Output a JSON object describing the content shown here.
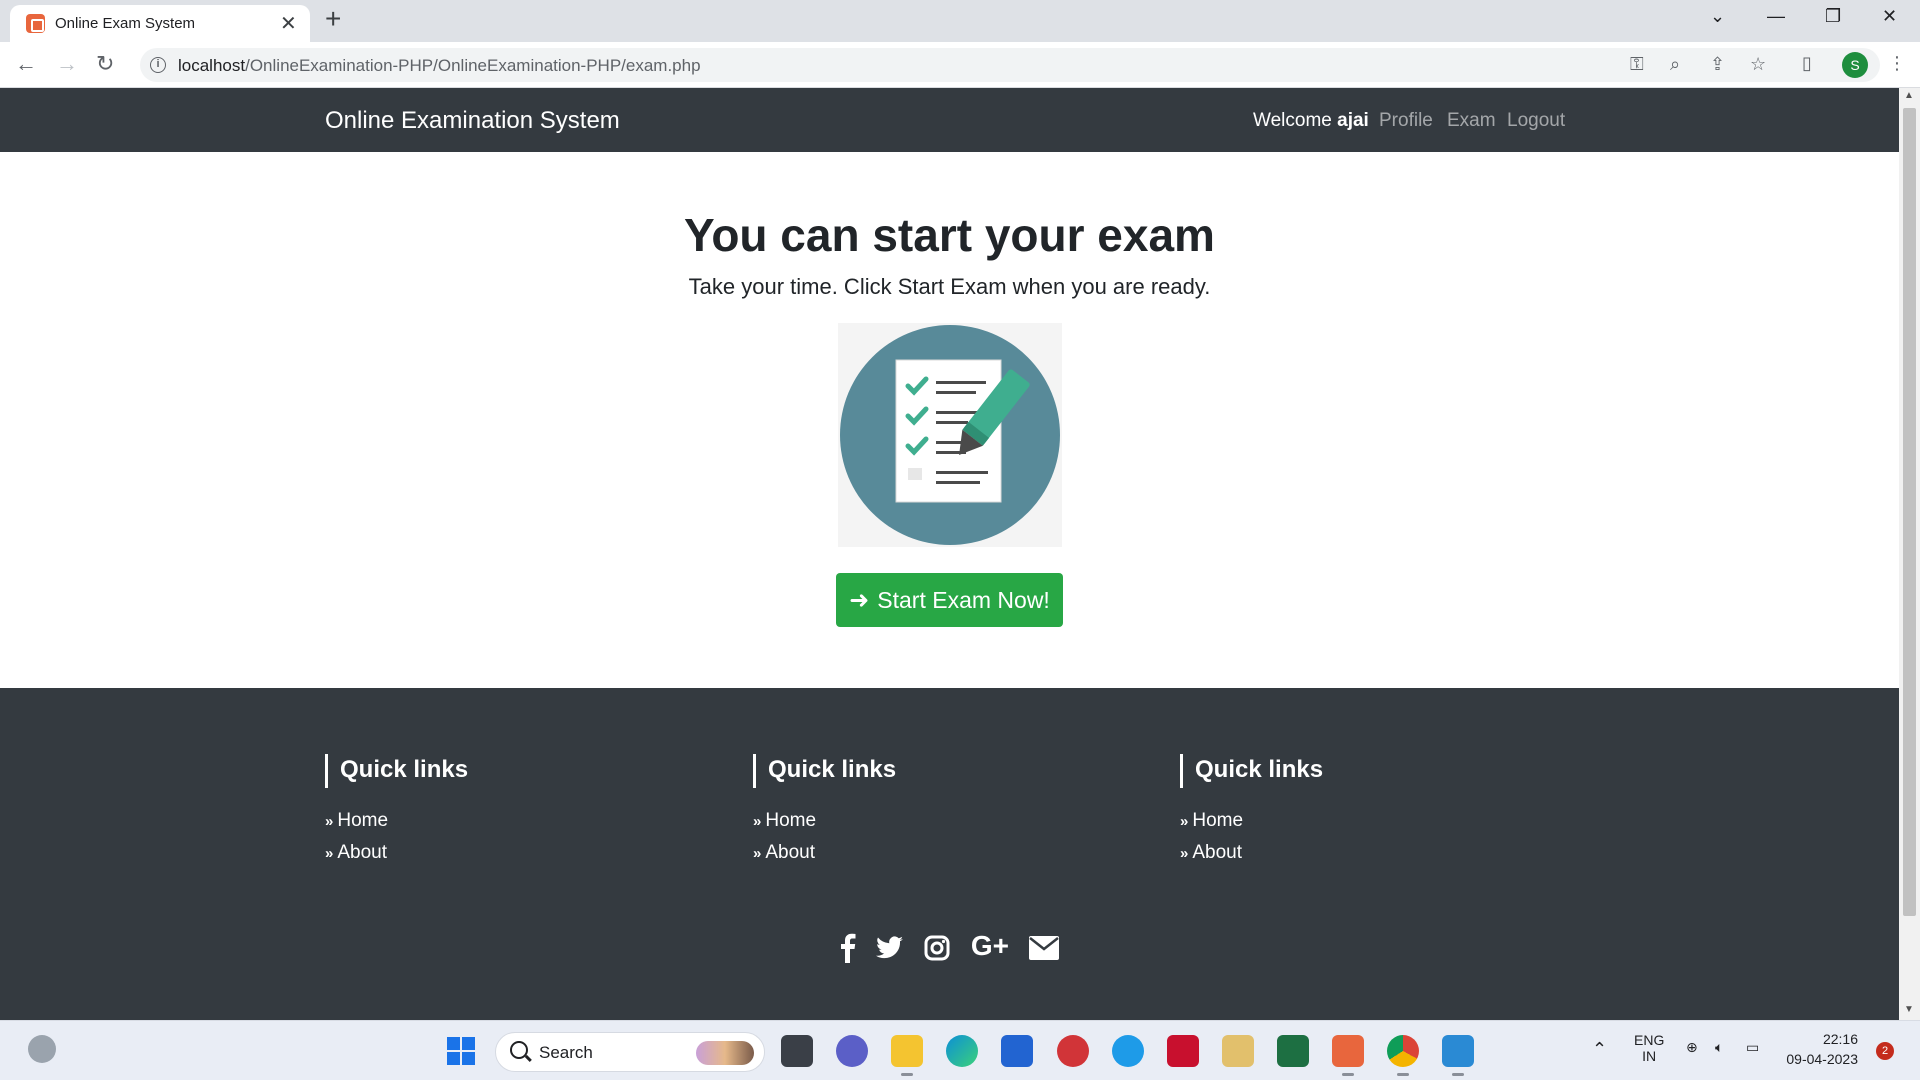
{
  "browser": {
    "tab_title": "Online Exam System",
    "url_host": "localhost",
    "url_path": "/OnlineExamination-PHP/OnlineExamination-PHP/exam.php",
    "profile_initial": "S"
  },
  "navbar": {
    "brand": "Online Examination System",
    "welcome_prefix": "Welcome ",
    "username": "ajai",
    "links": [
      "Profile",
      "Exam",
      "Logout"
    ]
  },
  "hero": {
    "title": "You can start your exam",
    "subtitle": "Take your time. Click Start Exam when you are ready.",
    "button_label": "Start Exam Now!"
  },
  "footer": {
    "columns": [
      {
        "title": "Quick links",
        "links": [
          "Home",
          "About"
        ]
      },
      {
        "title": "Quick links",
        "links": [
          "Home",
          "About"
        ]
      },
      {
        "title": "Quick links",
        "links": [
          "Home",
          "About"
        ]
      }
    ],
    "socials": [
      "facebook-icon",
      "twitter-icon",
      "instagram-icon",
      "google-plus-icon",
      "mail-icon"
    ],
    "google_plus_text": "G+"
  },
  "taskbar": {
    "search_placeholder": "Search",
    "lang_line1": "ENG",
    "lang_line2": "IN",
    "time": "22:16",
    "date": "09-04-2023",
    "notification_count": "2"
  },
  "colors": {
    "navbar_bg": "#343a40",
    "button_green": "#28a745",
    "illustration_circle": "#588a99",
    "checkmark_teal": "#3fae8f"
  }
}
